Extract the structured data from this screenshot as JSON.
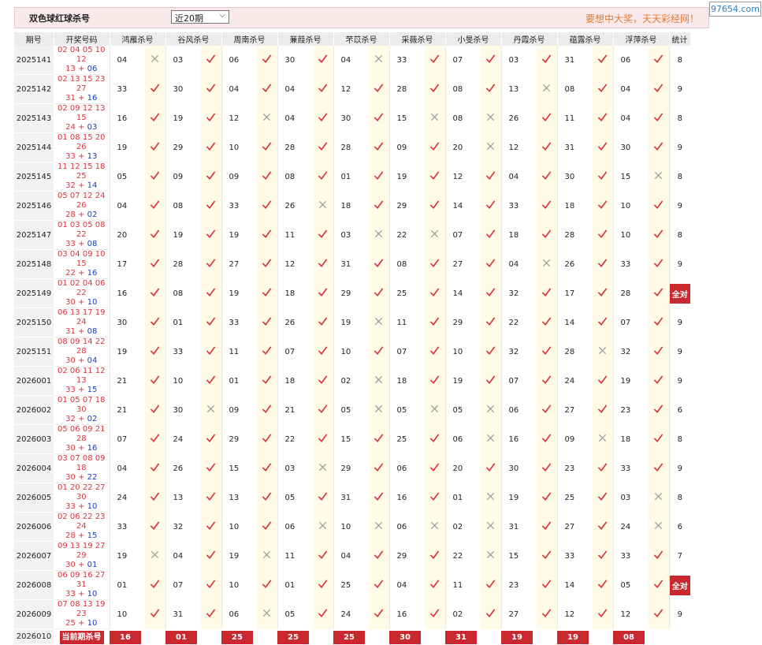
{
  "header": {
    "title": "双色球红球杀号",
    "selected_period": "近20期",
    "slogan": "要想中大奖，天天彩经网！"
  },
  "watermark": "97654.com",
  "columns": [
    "期号",
    "开奖号码",
    "鸿雁杀号",
    "谷风杀号",
    "周南杀号",
    "蒹葭杀号",
    "芣苡杀号",
    "采薇杀号",
    "小旻杀号",
    "丹霞杀号",
    "蕴露杀号",
    "浮萍杀号",
    "统计"
  ],
  "full_label": "全对",
  "rows": [
    {
      "issue": "2025141",
      "reds": "02 04 05 10 12",
      "reds2": "13",
      "blue": "06",
      "picks": [
        [
          "04",
          false
        ],
        [
          "03",
          true
        ],
        [
          "06",
          true
        ],
        [
          "30",
          true
        ],
        [
          "04",
          false
        ],
        [
          "33",
          true
        ],
        [
          "07",
          true
        ],
        [
          "03",
          true
        ],
        [
          "31",
          true
        ],
        [
          "06",
          true
        ]
      ],
      "stat": "8"
    },
    {
      "issue": "2025142",
      "reds": "02 13 15 23 27",
      "reds2": "31",
      "blue": "16",
      "picks": [
        [
          "33",
          true
        ],
        [
          "30",
          true
        ],
        [
          "04",
          true
        ],
        [
          "04",
          true
        ],
        [
          "12",
          true
        ],
        [
          "28",
          true
        ],
        [
          "08",
          true
        ],
        [
          "13",
          false
        ],
        [
          "08",
          true
        ],
        [
          "04",
          true
        ]
      ],
      "stat": "9"
    },
    {
      "issue": "2025143",
      "reds": "02 09 12 13 15",
      "reds2": "24",
      "blue": "03",
      "picks": [
        [
          "16",
          true
        ],
        [
          "19",
          true
        ],
        [
          "12",
          false
        ],
        [
          "04",
          true
        ],
        [
          "30",
          true
        ],
        [
          "15",
          false
        ],
        [
          "08",
          false
        ],
        [
          "26",
          true
        ],
        [
          "11",
          true
        ],
        [
          "04",
          true
        ]
      ],
      "stat": "8"
    },
    {
      "issue": "2025144",
      "reds": "01 08 15 20 26",
      "reds2": "33",
      "blue": "13",
      "picks": [
        [
          "19",
          true
        ],
        [
          "29",
          true
        ],
        [
          "10",
          true
        ],
        [
          "28",
          true
        ],
        [
          "28",
          true
        ],
        [
          "09",
          true
        ],
        [
          "20",
          false
        ],
        [
          "12",
          true
        ],
        [
          "31",
          true
        ],
        [
          "30",
          true
        ]
      ],
      "stat": "9"
    },
    {
      "issue": "2025145",
      "reds": "11 12 15 18 25",
      "reds2": "32",
      "blue": "14",
      "picks": [
        [
          "05",
          true
        ],
        [
          "09",
          true
        ],
        [
          "09",
          true
        ],
        [
          "08",
          true
        ],
        [
          "01",
          true
        ],
        [
          "19",
          true
        ],
        [
          "12",
          true
        ],
        [
          "04",
          true
        ],
        [
          "30",
          true
        ],
        [
          "15",
          false
        ]
      ],
      "stat": "8"
    },
    {
      "issue": "2025146",
      "reds": "05 07 12 24 26",
      "reds2": "28",
      "blue": "02",
      "picks": [
        [
          "04",
          true
        ],
        [
          "08",
          true
        ],
        [
          "33",
          true
        ],
        [
          "26",
          false
        ],
        [
          "18",
          true
        ],
        [
          "29",
          true
        ],
        [
          "14",
          true
        ],
        [
          "33",
          true
        ],
        [
          "18",
          true
        ],
        [
          "10",
          true
        ]
      ],
      "stat": "9"
    },
    {
      "issue": "2025147",
      "reds": "01 03 05 08 22",
      "reds2": "33",
      "blue": "08",
      "picks": [
        [
          "20",
          true
        ],
        [
          "19",
          true
        ],
        [
          "19",
          true
        ],
        [
          "11",
          true
        ],
        [
          "03",
          false
        ],
        [
          "22",
          false
        ],
        [
          "07",
          true
        ],
        [
          "18",
          true
        ],
        [
          "28",
          true
        ],
        [
          "10",
          true
        ]
      ],
      "stat": "8"
    },
    {
      "issue": "2025148",
      "reds": "03 04 09 10 15",
      "reds2": "22",
      "blue": "16",
      "picks": [
        [
          "17",
          true
        ],
        [
          "28",
          true
        ],
        [
          "27",
          true
        ],
        [
          "12",
          true
        ],
        [
          "31",
          true
        ],
        [
          "08",
          true
        ],
        [
          "27",
          true
        ],
        [
          "04",
          false
        ],
        [
          "26",
          true
        ],
        [
          "33",
          true
        ]
      ],
      "stat": "9"
    },
    {
      "issue": "2025149",
      "reds": "01 02 04 06 22",
      "reds2": "30",
      "blue": "10",
      "picks": [
        [
          "16",
          true
        ],
        [
          "08",
          true
        ],
        [
          "19",
          true
        ],
        [
          "18",
          true
        ],
        [
          "29",
          true
        ],
        [
          "25",
          true
        ],
        [
          "14",
          true
        ],
        [
          "32",
          true
        ],
        [
          "17",
          true
        ],
        [
          "28",
          true
        ]
      ],
      "stat": "全对"
    },
    {
      "issue": "2025150",
      "reds": "06 13 17 19 24",
      "reds2": "31",
      "blue": "08",
      "picks": [
        [
          "30",
          true
        ],
        [
          "01",
          true
        ],
        [
          "33",
          true
        ],
        [
          "26",
          true
        ],
        [
          "19",
          false
        ],
        [
          "11",
          true
        ],
        [
          "29",
          true
        ],
        [
          "22",
          true
        ],
        [
          "14",
          true
        ],
        [
          "07",
          true
        ]
      ],
      "stat": "9"
    },
    {
      "issue": "2025151",
      "reds": "08 09 14 22 28",
      "reds2": "30",
      "blue": "04",
      "picks": [
        [
          "19",
          true
        ],
        [
          "33",
          true
        ],
        [
          "11",
          true
        ],
        [
          "07",
          true
        ],
        [
          "10",
          true
        ],
        [
          "07",
          true
        ],
        [
          "10",
          true
        ],
        [
          "32",
          true
        ],
        [
          "28",
          false
        ],
        [
          "32",
          true
        ]
      ],
      "stat": "9"
    },
    {
      "issue": "2026001",
      "reds": "02 06 11 12 13",
      "reds2": "33",
      "blue": "15",
      "picks": [
        [
          "21",
          true
        ],
        [
          "10",
          true
        ],
        [
          "01",
          true
        ],
        [
          "18",
          true
        ],
        [
          "02",
          false
        ],
        [
          "18",
          true
        ],
        [
          "19",
          true
        ],
        [
          "07",
          true
        ],
        [
          "24",
          true
        ],
        [
          "19",
          true
        ]
      ],
      "stat": "9"
    },
    {
      "issue": "2026002",
      "reds": "01 05 07 18 30",
      "reds2": "32",
      "blue": "02",
      "picks": [
        [
          "21",
          true
        ],
        [
          "30",
          false
        ],
        [
          "09",
          true
        ],
        [
          "21",
          true
        ],
        [
          "05",
          false
        ],
        [
          "05",
          false
        ],
        [
          "05",
          false
        ],
        [
          "06",
          true
        ],
        [
          "27",
          true
        ],
        [
          "23",
          true
        ]
      ],
      "stat": "6"
    },
    {
      "issue": "2026003",
      "reds": "05 06 09 21 28",
      "reds2": "30",
      "blue": "16",
      "picks": [
        [
          "07",
          true
        ],
        [
          "24",
          true
        ],
        [
          "29",
          true
        ],
        [
          "22",
          true
        ],
        [
          "15",
          true
        ],
        [
          "25",
          true
        ],
        [
          "06",
          false
        ],
        [
          "16",
          true
        ],
        [
          "09",
          false
        ],
        [
          "18",
          true
        ]
      ],
      "stat": "8"
    },
    {
      "issue": "2026004",
      "reds": "03 07 08 09 18",
      "reds2": "30",
      "blue": "22",
      "picks": [
        [
          "04",
          true
        ],
        [
          "26",
          true
        ],
        [
          "15",
          true
        ],
        [
          "03",
          false
        ],
        [
          "29",
          true
        ],
        [
          "06",
          true
        ],
        [
          "20",
          true
        ],
        [
          "30",
          true
        ],
        [
          "23",
          true
        ],
        [
          "33",
          true
        ]
      ],
      "stat": "9"
    },
    {
      "issue": "2026005",
      "reds": "01 20 22 27 30",
      "reds2": "33",
      "blue": "10",
      "picks": [
        [
          "24",
          true
        ],
        [
          "13",
          true
        ],
        [
          "13",
          true
        ],
        [
          "05",
          true
        ],
        [
          "31",
          true
        ],
        [
          "16",
          true
        ],
        [
          "01",
          false
        ],
        [
          "19",
          true
        ],
        [
          "25",
          true
        ],
        [
          "03",
          false
        ]
      ],
      "stat": "8"
    },
    {
      "issue": "2026006",
      "reds": "02 06 22 23 24",
      "reds2": "28",
      "blue": "15",
      "picks": [
        [
          "33",
          true
        ],
        [
          "32",
          true
        ],
        [
          "10",
          true
        ],
        [
          "06",
          false
        ],
        [
          "10",
          false
        ],
        [
          "06",
          false
        ],
        [
          "02",
          false
        ],
        [
          "31",
          true
        ],
        [
          "27",
          true
        ],
        [
          "24",
          false
        ]
      ],
      "stat": "6"
    },
    {
      "issue": "2026007",
      "reds": "09 13 19 27 29",
      "reds2": "30",
      "blue": "01",
      "picks": [
        [
          "19",
          false
        ],
        [
          "04",
          true
        ],
        [
          "19",
          false
        ],
        [
          "11",
          true
        ],
        [
          "04",
          true
        ],
        [
          "29",
          true
        ],
        [
          "22",
          false
        ],
        [
          "15",
          true
        ],
        [
          "33",
          true
        ],
        [
          "33",
          true
        ]
      ],
      "stat": "7"
    },
    {
      "issue": "2026008",
      "reds": "06 09 16 27 31",
      "reds2": "33",
      "blue": "10",
      "picks": [
        [
          "01",
          true
        ],
        [
          "07",
          true
        ],
        [
          "10",
          true
        ],
        [
          "01",
          true
        ],
        [
          "25",
          true
        ],
        [
          "04",
          true
        ],
        [
          "11",
          true
        ],
        [
          "23",
          true
        ],
        [
          "14",
          true
        ],
        [
          "05",
          true
        ]
      ],
      "stat": "全对"
    },
    {
      "issue": "2026009",
      "reds": "07 08 13 19 23",
      "reds2": "25",
      "blue": "10",
      "picks": [
        [
          "10",
          true
        ],
        [
          "31",
          true
        ],
        [
          "06",
          false
        ],
        [
          "05",
          true
        ],
        [
          "24",
          true
        ],
        [
          "16",
          true
        ],
        [
          "02",
          true
        ],
        [
          "27",
          true
        ],
        [
          "12",
          true
        ],
        [
          "12",
          true
        ]
      ],
      "stat": "9"
    }
  ],
  "current": {
    "issue": "2026010",
    "label": "当前期杀号",
    "picks": [
      "16",
      "01",
      "25",
      "25",
      "25",
      "30",
      "31",
      "19",
      "19",
      "08"
    ]
  },
  "colors": {
    "accent_red": "#c8282e",
    "check_red": "#d9363e",
    "cross_gray": "#9a9a9a",
    "highlight_yellow": "#fffbe6"
  }
}
